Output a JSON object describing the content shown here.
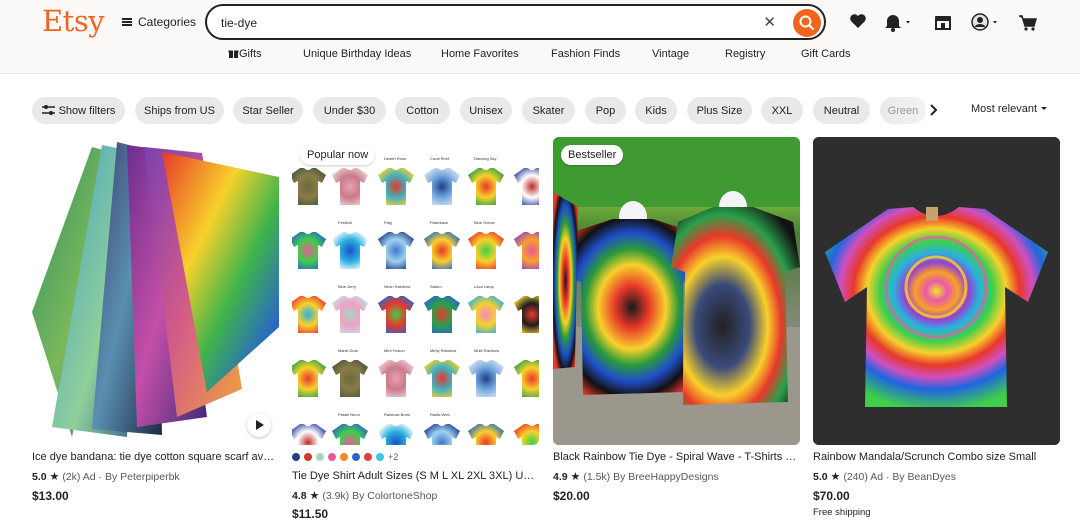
{
  "header": {
    "logo": "Etsy",
    "categories_label": "Categories",
    "search_value": "tie-dye",
    "accent_color": "#f1641e",
    "icons": [
      "favorites-heart-icon",
      "notifications-bell-icon",
      "shop-manager-icon",
      "account-avatar-icon",
      "cart-icon"
    ]
  },
  "nav": {
    "links": [
      "Gifts",
      "Unique Birthday Ideas",
      "Home Favorites",
      "Fashion Finds",
      "Vintage",
      "Registry",
      "Gift Cards"
    ]
  },
  "filters": {
    "show_filters": "Show filters",
    "chips": [
      "Ships from US",
      "Star Seller",
      "Under $30",
      "Cotton",
      "Unisex",
      "Skater",
      "Pop",
      "Kids",
      "Plus Size",
      "XXL",
      "Neutral",
      "Green"
    ],
    "sort_label": "Most relevant"
  },
  "listings": [
    {
      "badge": "",
      "title": "Ice dye bandana: tie dye cotton square scarf availabl...",
      "rating": "5.0",
      "reviews": "(2k)",
      "ad": "Ad",
      "shop": "By Peterpiperbk",
      "price": "$13.00",
      "shipping": ""
    },
    {
      "badge": "Popular now",
      "title": "Tie Dye Shirt Adult Sizes (S M L XL 2XL 3XL) Unisex ...",
      "rating": "4.8",
      "reviews": "(3.9k)",
      "ad": "",
      "shop": "By ColortoneShop",
      "price": "$11.50",
      "shipping": "",
      "swatch_colors": [
        "#1f3f8a",
        "#d13a2a",
        "#a7d7c5",
        "#e85a9a",
        "#f08a24",
        "#2a66c9",
        "#e23c3c",
        "#3cc6e0"
      ],
      "swatch_more": "+2",
      "grid_labels": [
        "Camo",
        "Desert Rose",
        "Coral Reef",
        "Dancing Sky",
        "Festival",
        "Flag",
        "Flashback",
        "Blue Ocean",
        "Blue Jerry",
        "Neon Rainbow",
        "Saturn",
        "Lava Lamp",
        "Mardi Gras",
        "Mint Fusion",
        "Minty Rainbow",
        "Multi Rainbow",
        "Pastel Neon",
        "Rainbow Burst",
        "Rasta Web"
      ]
    },
    {
      "badge": "Bestseller",
      "title": "Black Rainbow Tie Dye - Spiral Wave - T-Shirts Long ...",
      "rating": "4.9",
      "reviews": "(1.5k)",
      "ad": "",
      "shop": "By BreeHappyDesigns",
      "price": "$20.00",
      "shipping": ""
    },
    {
      "badge": "",
      "title": "Rainbow Mandala/Scrunch Combo size Small",
      "rating": "5.0",
      "reviews": "(240)",
      "ad": "Ad",
      "shop": "By BeanDyes",
      "price": "$70.00",
      "shipping": "Free shipping"
    }
  ]
}
